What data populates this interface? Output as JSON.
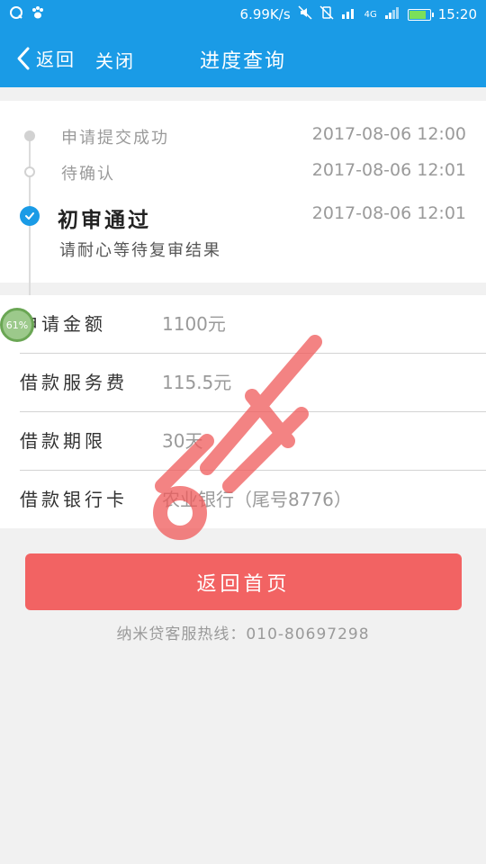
{
  "status_bar": {
    "left_icons": [
      "qq-icon",
      "baidu-paw-icon"
    ],
    "net_speed": "6.99K/s",
    "network_type": "4G",
    "time": "15:20",
    "battery_percent": 85,
    "colors": {
      "bar": "#1a9be6",
      "battery_fill": "#7be05a"
    }
  },
  "nav": {
    "back_label": "返回",
    "close_label": "关闭",
    "title": "进度查询"
  },
  "progress": {
    "steps": [
      {
        "label": "申请提交成功",
        "time": "2017-08-06 12:00",
        "state": "done"
      },
      {
        "label": "待确认",
        "time": "2017-08-06 12:01",
        "state": "done"
      },
      {
        "label": "初审通过",
        "time": "2017-08-06 12:01",
        "state": "current"
      }
    ],
    "current_note": "请耐心等待复审结果"
  },
  "details": [
    {
      "key": "申请金额",
      "value": "1100元"
    },
    {
      "key": "借款服务费",
      "value": "115.5元"
    },
    {
      "key": "借款期限",
      "value": "30天"
    },
    {
      "key": "借款银行卡",
      "value": "农业银行（尾号8776）"
    }
  ],
  "floating_badge": "61%",
  "actions": {
    "home_button": "返回首页"
  },
  "hotline": "纳米贷客服热线：010-80697298",
  "watermark": {
    "text": "卡农社区",
    "color": "#f05a5a"
  },
  "colors": {
    "primary": "#1a9be6",
    "button": "#f26363",
    "background": "#f1f1f1"
  }
}
